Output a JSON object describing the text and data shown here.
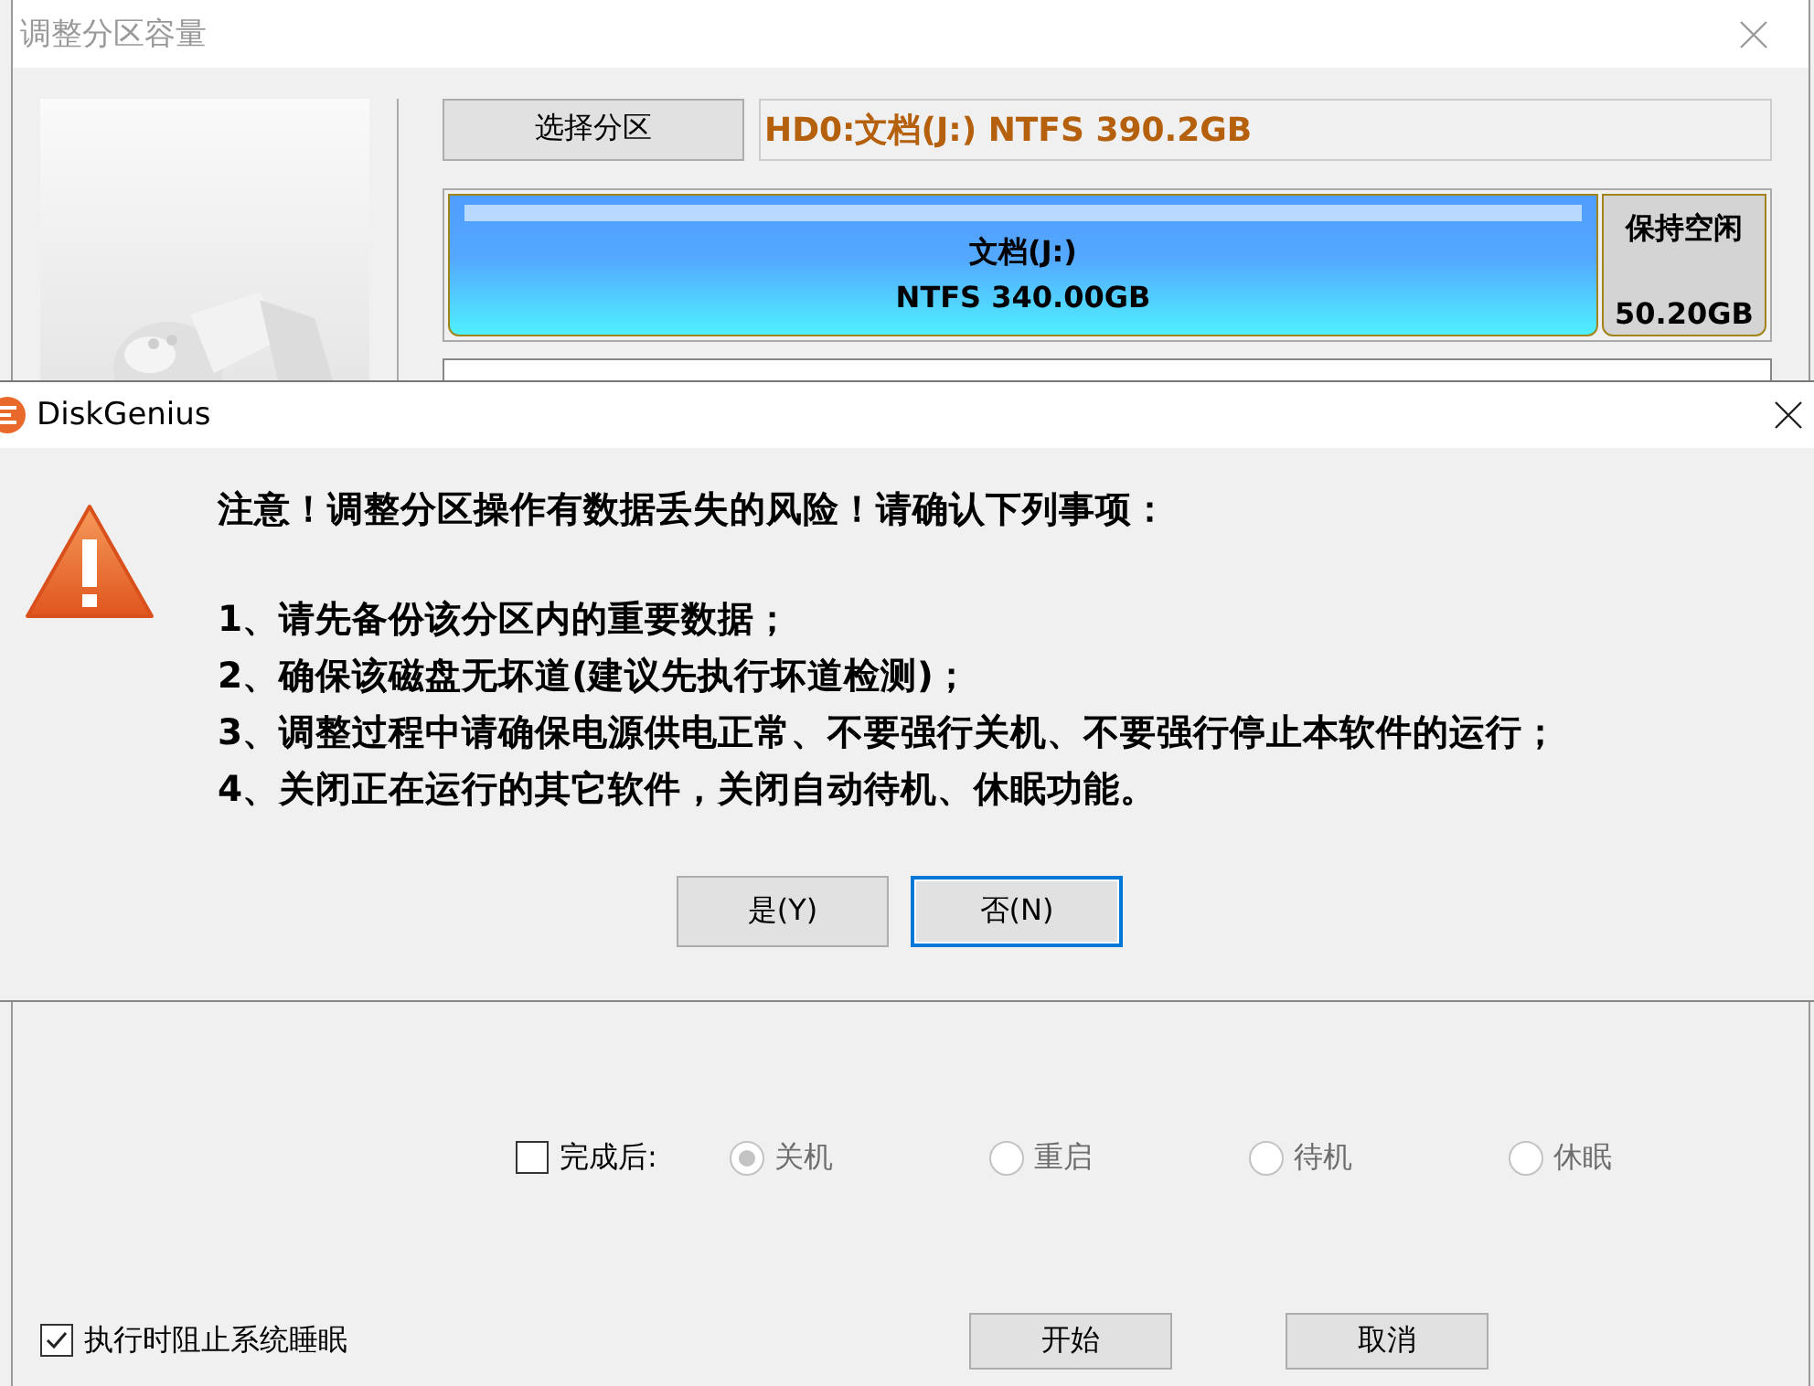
{
  "window": {
    "title": "调整分区容量"
  },
  "select_button": "选择分区",
  "partition_info": "HD0:文档(J:) NTFS 390.2GB",
  "partition_bar": [
    {
      "kind": "partition",
      "name": "文档(J:)",
      "detail": "NTFS 340.00GB"
    },
    {
      "kind": "free",
      "name": "保持空闲",
      "detail": "50.20GB"
    }
  ],
  "after_completion": {
    "label": "完成后:",
    "checked": false,
    "options": [
      {
        "label": "关机",
        "selected": true,
        "disabled": true
      },
      {
        "label": "重启",
        "selected": false,
        "disabled": true
      },
      {
        "label": "待机",
        "selected": false,
        "disabled": true
      },
      {
        "label": "休眠",
        "selected": false,
        "disabled": true
      }
    ]
  },
  "prevent_sleep": {
    "label": "执行时阻止系统睡眠",
    "checked": true
  },
  "buttons": [
    "开始",
    "取消"
  ],
  "dialog": {
    "title": "DiskGenius",
    "heading": "注意！调整分区操作有数据丢失的风险！请确认下列事项：",
    "items": [
      "1、请先备份该分区内的重要数据；",
      "2、确保该磁盘无坏道(建议先执行坏道检测)；",
      "3、调整过程中请确保电源供电正常、不要强行关机、不要强行停止本软件的运行；",
      "4、关闭正在运行的其它软件，关闭自动待机、休眠功能。"
    ],
    "buttons": [
      {
        "label": "是(Y)",
        "focused": false
      },
      {
        "label": "否(N)",
        "focused": true
      }
    ]
  }
}
